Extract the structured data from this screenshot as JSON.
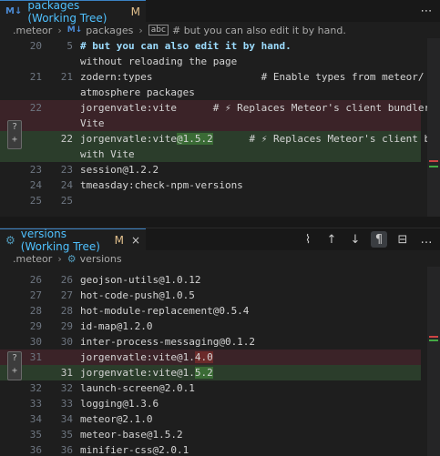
{
  "pane1": {
    "tab": {
      "icon": "M↓",
      "label": "packages (Working Tree)",
      "modified": "M",
      "close": "×"
    },
    "breadcrumb": {
      "folder": ".meteor",
      "file": "packages",
      "symbol": "# but you can also edit it by hand."
    },
    "lines": [
      {
        "left": "20",
        "right": "5",
        "text": "# but you can also edit it by hand.",
        "kind": "comment"
      },
      {
        "left": "",
        "right": "",
        "text": "without reloading the page",
        "kind": "plain"
      },
      {
        "left": "21",
        "right": "21",
        "text": "zodern:types                  # Enable types from meteor/",
        "kind": "plain"
      },
      {
        "left": "",
        "right": "",
        "text": "atmosphere packages",
        "kind": "plain"
      },
      {
        "left": "22",
        "right": "",
        "text": "jorgenvatle:vite      # ⚡ Replaces Meteor's client bundler with",
        "kind": "del"
      },
      {
        "left": "",
        "right": "",
        "text": "Vite",
        "kind": "del"
      },
      {
        "left": "",
        "right": "22",
        "pre": "jorgenvatle:vite",
        "hl": "@1.5.2",
        "post": "      # ⚡ Replaces Meteor's client bundler",
        "kind": "ins"
      },
      {
        "left": "",
        "right": "",
        "text": "with Vite",
        "kind": "ins"
      },
      {
        "left": "23",
        "right": "23",
        "text": "session@1.2.2",
        "kind": "plain"
      },
      {
        "left": "24",
        "right": "24",
        "text": "tmeasday:check-npm-versions",
        "kind": "plain"
      },
      {
        "left": "25",
        "right": "25",
        "text": "",
        "kind": "plain"
      }
    ]
  },
  "pane2": {
    "tab": {
      "icon": "⚙",
      "label": "versions (Working Tree)",
      "modified": "M",
      "close": "×"
    },
    "breadcrumb": {
      "folder": ".meteor",
      "file": "versions"
    },
    "actions": [
      "⌇",
      "↑",
      "↓",
      "¶",
      "⊟",
      "…"
    ],
    "lines": [
      {
        "left": "26",
        "right": "26",
        "text": "geojson-utils@1.0.12",
        "kind": "plain"
      },
      {
        "left": "27",
        "right": "27",
        "text": "hot-code-push@1.0.5",
        "kind": "plain"
      },
      {
        "left": "28",
        "right": "28",
        "text": "hot-module-replacement@0.5.4",
        "kind": "plain"
      },
      {
        "left": "29",
        "right": "29",
        "text": "id-map@1.2.0",
        "kind": "plain"
      },
      {
        "left": "30",
        "right": "30",
        "text": "inter-process-messaging@0.1.2",
        "kind": "plain"
      },
      {
        "left": "31",
        "right": "",
        "pre": "jorgenvatle:vite@1.",
        "hl": "4.0",
        "post": "",
        "kind": "del"
      },
      {
        "left": "",
        "right": "31",
        "pre": "jorgenvatle:vite@1.",
        "hl": "5.2",
        "post": "",
        "kind": "ins"
      },
      {
        "left": "32",
        "right": "32",
        "text": "launch-screen@2.0.1",
        "kind": "plain"
      },
      {
        "left": "33",
        "right": "33",
        "text": "logging@1.3.6",
        "kind": "plain"
      },
      {
        "left": "34",
        "right": "34",
        "text": "meteor@2.1.0",
        "kind": "plain"
      },
      {
        "left": "35",
        "right": "35",
        "text": "meteor-base@1.5.2",
        "kind": "plain"
      },
      {
        "left": "36",
        "right": "36",
        "text": "minifier-css@2.0.1",
        "kind": "plain"
      }
    ]
  },
  "ui": {
    "revert_glyph": "?",
    "stage_glyph": "+"
  }
}
